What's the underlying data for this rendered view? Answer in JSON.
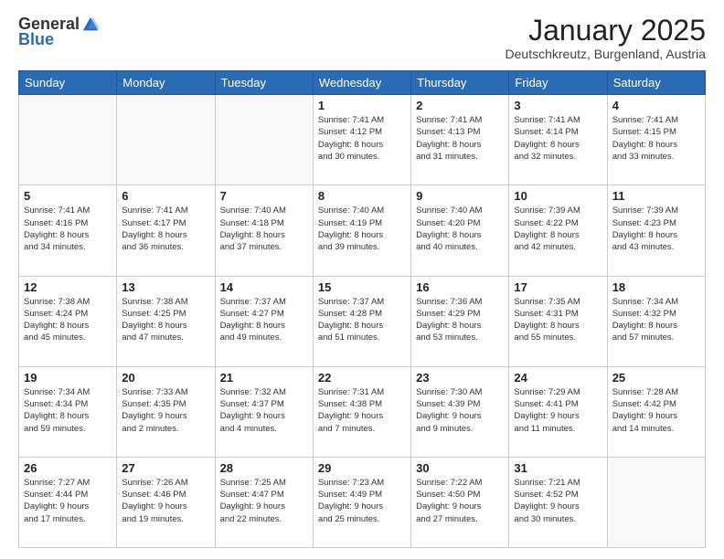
{
  "logo": {
    "general": "General",
    "blue": "Blue"
  },
  "header": {
    "month": "January 2025",
    "location": "Deutschkreutz, Burgenland, Austria"
  },
  "weekdays": [
    "Sunday",
    "Monday",
    "Tuesday",
    "Wednesday",
    "Thursday",
    "Friday",
    "Saturday"
  ],
  "weeks": [
    [
      {
        "day": "",
        "info": ""
      },
      {
        "day": "",
        "info": ""
      },
      {
        "day": "",
        "info": ""
      },
      {
        "day": "1",
        "info": "Sunrise: 7:41 AM\nSunset: 4:12 PM\nDaylight: 8 hours\nand 30 minutes."
      },
      {
        "day": "2",
        "info": "Sunrise: 7:41 AM\nSunset: 4:13 PM\nDaylight: 8 hours\nand 31 minutes."
      },
      {
        "day": "3",
        "info": "Sunrise: 7:41 AM\nSunset: 4:14 PM\nDaylight: 8 hours\nand 32 minutes."
      },
      {
        "day": "4",
        "info": "Sunrise: 7:41 AM\nSunset: 4:15 PM\nDaylight: 8 hours\nand 33 minutes."
      }
    ],
    [
      {
        "day": "5",
        "info": "Sunrise: 7:41 AM\nSunset: 4:16 PM\nDaylight: 8 hours\nand 34 minutes."
      },
      {
        "day": "6",
        "info": "Sunrise: 7:41 AM\nSunset: 4:17 PM\nDaylight: 8 hours\nand 36 minutes."
      },
      {
        "day": "7",
        "info": "Sunrise: 7:40 AM\nSunset: 4:18 PM\nDaylight: 8 hours\nand 37 minutes."
      },
      {
        "day": "8",
        "info": "Sunrise: 7:40 AM\nSunset: 4:19 PM\nDaylight: 8 hours\nand 39 minutes."
      },
      {
        "day": "9",
        "info": "Sunrise: 7:40 AM\nSunset: 4:20 PM\nDaylight: 8 hours\nand 40 minutes."
      },
      {
        "day": "10",
        "info": "Sunrise: 7:39 AM\nSunset: 4:22 PM\nDaylight: 8 hours\nand 42 minutes."
      },
      {
        "day": "11",
        "info": "Sunrise: 7:39 AM\nSunset: 4:23 PM\nDaylight: 8 hours\nand 43 minutes."
      }
    ],
    [
      {
        "day": "12",
        "info": "Sunrise: 7:38 AM\nSunset: 4:24 PM\nDaylight: 8 hours\nand 45 minutes."
      },
      {
        "day": "13",
        "info": "Sunrise: 7:38 AM\nSunset: 4:25 PM\nDaylight: 8 hours\nand 47 minutes."
      },
      {
        "day": "14",
        "info": "Sunrise: 7:37 AM\nSunset: 4:27 PM\nDaylight: 8 hours\nand 49 minutes."
      },
      {
        "day": "15",
        "info": "Sunrise: 7:37 AM\nSunset: 4:28 PM\nDaylight: 8 hours\nand 51 minutes."
      },
      {
        "day": "16",
        "info": "Sunrise: 7:36 AM\nSunset: 4:29 PM\nDaylight: 8 hours\nand 53 minutes."
      },
      {
        "day": "17",
        "info": "Sunrise: 7:35 AM\nSunset: 4:31 PM\nDaylight: 8 hours\nand 55 minutes."
      },
      {
        "day": "18",
        "info": "Sunrise: 7:34 AM\nSunset: 4:32 PM\nDaylight: 8 hours\nand 57 minutes."
      }
    ],
    [
      {
        "day": "19",
        "info": "Sunrise: 7:34 AM\nSunset: 4:34 PM\nDaylight: 8 hours\nand 59 minutes."
      },
      {
        "day": "20",
        "info": "Sunrise: 7:33 AM\nSunset: 4:35 PM\nDaylight: 9 hours\nand 2 minutes."
      },
      {
        "day": "21",
        "info": "Sunrise: 7:32 AM\nSunset: 4:37 PM\nDaylight: 9 hours\nand 4 minutes."
      },
      {
        "day": "22",
        "info": "Sunrise: 7:31 AM\nSunset: 4:38 PM\nDaylight: 9 hours\nand 7 minutes."
      },
      {
        "day": "23",
        "info": "Sunrise: 7:30 AM\nSunset: 4:39 PM\nDaylight: 9 hours\nand 9 minutes."
      },
      {
        "day": "24",
        "info": "Sunrise: 7:29 AM\nSunset: 4:41 PM\nDaylight: 9 hours\nand 11 minutes."
      },
      {
        "day": "25",
        "info": "Sunrise: 7:28 AM\nSunset: 4:42 PM\nDaylight: 9 hours\nand 14 minutes."
      }
    ],
    [
      {
        "day": "26",
        "info": "Sunrise: 7:27 AM\nSunset: 4:44 PM\nDaylight: 9 hours\nand 17 minutes."
      },
      {
        "day": "27",
        "info": "Sunrise: 7:26 AM\nSunset: 4:46 PM\nDaylight: 9 hours\nand 19 minutes."
      },
      {
        "day": "28",
        "info": "Sunrise: 7:25 AM\nSunset: 4:47 PM\nDaylight: 9 hours\nand 22 minutes."
      },
      {
        "day": "29",
        "info": "Sunrise: 7:23 AM\nSunset: 4:49 PM\nDaylight: 9 hours\nand 25 minutes."
      },
      {
        "day": "30",
        "info": "Sunrise: 7:22 AM\nSunset: 4:50 PM\nDaylight: 9 hours\nand 27 minutes."
      },
      {
        "day": "31",
        "info": "Sunrise: 7:21 AM\nSunset: 4:52 PM\nDaylight: 9 hours\nand 30 minutes."
      },
      {
        "day": "",
        "info": ""
      }
    ]
  ]
}
